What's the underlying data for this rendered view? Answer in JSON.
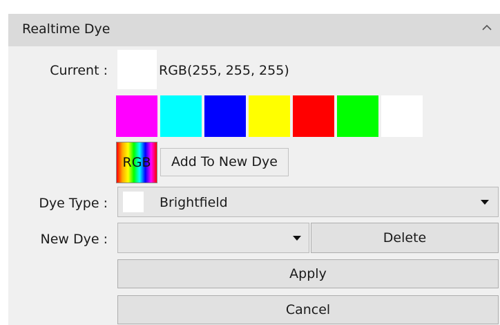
{
  "panel": {
    "title": "Realtime Dye",
    "collapse_icon": "chevron-up-icon"
  },
  "current": {
    "label": "Current :",
    "color": "#ffffff",
    "value_text": "RGB(255, 255, 255)"
  },
  "palette": [
    {
      "name": "magenta",
      "color": "#ff00ff"
    },
    {
      "name": "cyan",
      "color": "#00ffff"
    },
    {
      "name": "blue",
      "color": "#0000ff"
    },
    {
      "name": "yellow",
      "color": "#ffff00"
    },
    {
      "name": "red",
      "color": "#ff0000"
    },
    {
      "name": "green",
      "color": "#00ff00"
    },
    {
      "name": "white",
      "color": "#ffffff"
    }
  ],
  "rgb_picker": {
    "label": "RGB"
  },
  "add_button": {
    "label": "Add To New Dye"
  },
  "dye_type": {
    "label": "Dye Type :",
    "selected": "Brightfield",
    "swatch_color": "#ffffff"
  },
  "new_dye": {
    "label": "New Dye :",
    "selected": "",
    "delete_label": "Delete"
  },
  "actions": {
    "apply_label": "Apply",
    "cancel_label": "Cancel"
  }
}
